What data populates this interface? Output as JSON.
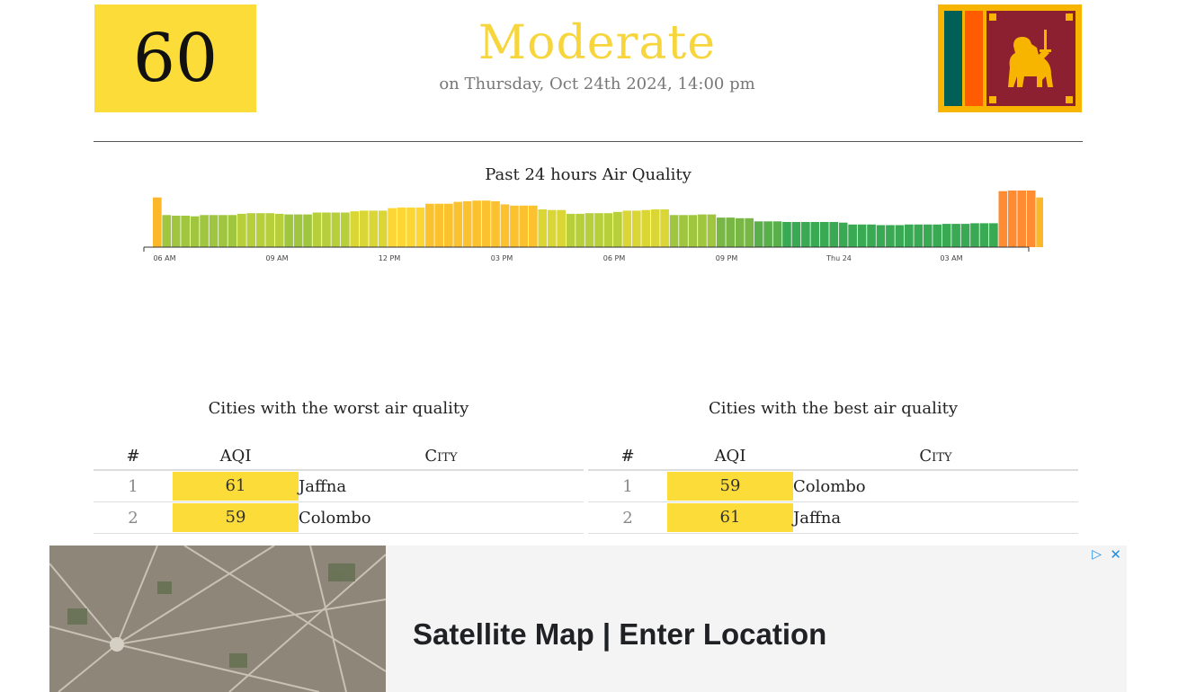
{
  "summary": {
    "aqi": "60",
    "level": "Moderate",
    "timestamp": "on Thursday, Oct 24th 2024, 14:00 pm"
  },
  "colors": {
    "moderate": "#fcdc38",
    "good": "#3aac56",
    "unhealthy_sensitive": "#ff9138"
  },
  "chart_title": "Past 24 hours Air Quality",
  "chart_data": {
    "type": "bar",
    "title": "Past 24 hours Air Quality",
    "xlabel": "",
    "ylabel": "",
    "x_tick_labels": [
      "06 AM",
      "09 AM",
      "12 PM",
      "03 PM",
      "06 PM",
      "09 PM",
      "Thu 24",
      "03 AM"
    ],
    "grid": false,
    "values": [
      79,
      51,
      50,
      50,
      49,
      51,
      51,
      51,
      51,
      53,
      54,
      54,
      54,
      53,
      52,
      52,
      52,
      55,
      55,
      55,
      55,
      57,
      58,
      58,
      58,
      62,
      63,
      63,
      63,
      69,
      69,
      69,
      72,
      73,
      74,
      74,
      73,
      68,
      66,
      66,
      66,
      60,
      59,
      59,
      53,
      53,
      54,
      54,
      54,
      56,
      58,
      58,
      59,
      60,
      60,
      51,
      51,
      51,
      52,
      52,
      47,
      47,
      46,
      46,
      41,
      41,
      41,
      40,
      40,
      40,
      40,
      40,
      40,
      39,
      36,
      36,
      36,
      35,
      35,
      35,
      36,
      36,
      36,
      36,
      37,
      37,
      37,
      38,
      38,
      38,
      89,
      90,
      90,
      90,
      79,
      79,
      79,
      79,
      72,
      72,
      72,
      72
    ]
  },
  "worst": {
    "title": "Cities with the worst air quality",
    "headers": {
      "rank": "#",
      "aqi": "AQI",
      "city": "City"
    },
    "rows": [
      {
        "rank": "1",
        "aqi": "61",
        "city": "Jaffna"
      },
      {
        "rank": "2",
        "aqi": "59",
        "city": "Colombo"
      }
    ]
  },
  "best": {
    "title": "Cities with the best air quality",
    "headers": {
      "rank": "#",
      "aqi": "AQI",
      "city": "City"
    },
    "rows": [
      {
        "rank": "1",
        "aqi": "59",
        "city": "Colombo"
      },
      {
        "rank": "2",
        "aqi": "61",
        "city": "Jaffna"
      }
    ]
  },
  "ad": {
    "headline": "Satellite Map | Enter Location",
    "choices_icon": "adchoices-icon",
    "close_icon": "close-icon"
  }
}
